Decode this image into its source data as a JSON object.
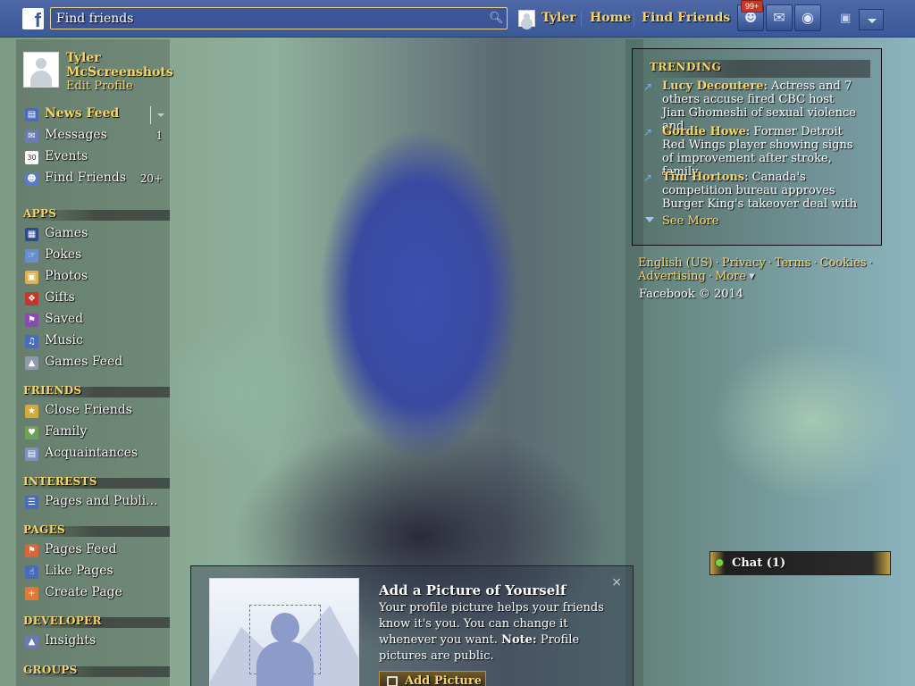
{
  "header": {
    "search": {
      "placeholder": "Find friends"
    },
    "user_name": "Tyler",
    "nav": {
      "home": "Home",
      "find_friends": "Find Friends"
    },
    "notification_badge": "99+",
    "colors": {
      "bar": "#3b5998",
      "accent": "#f5d46b"
    }
  },
  "profile": {
    "name": "Tyler McScreenshots",
    "edit_label": "Edit Profile"
  },
  "sidebar": {
    "favorites": [
      {
        "label": "News Feed",
        "icon": "news-feed-icon",
        "count": ""
      },
      {
        "label": "Messages",
        "icon": "messages-icon",
        "count": "1"
      },
      {
        "label": "Events",
        "icon": "calendar-icon",
        "count": "",
        "glyph": "30"
      },
      {
        "label": "Find Friends",
        "icon": "find-friends-icon",
        "count": "20+"
      }
    ],
    "apps_header": "APPS",
    "apps": [
      {
        "label": "Games",
        "icon": "games-icon"
      },
      {
        "label": "Pokes",
        "icon": "pokes-icon"
      },
      {
        "label": "Photos",
        "icon": "photos-icon"
      },
      {
        "label": "Gifts",
        "icon": "gifts-icon"
      },
      {
        "label": "Saved",
        "icon": "saved-icon"
      },
      {
        "label": "Music",
        "icon": "music-icon"
      },
      {
        "label": "Games Feed",
        "icon": "games-feed-icon"
      }
    ],
    "friends_header": "FRIENDS",
    "friends": [
      {
        "label": "Close Friends",
        "icon": "close-friends-icon"
      },
      {
        "label": "Family",
        "icon": "family-icon"
      },
      {
        "label": "Acquaintances",
        "icon": "acquaintances-icon"
      }
    ],
    "interests_header": "INTERESTS",
    "interests": [
      {
        "label": "Pages and Publi...",
        "icon": "rss-icon"
      }
    ],
    "pages_header": "PAGES",
    "pages": [
      {
        "label": "Pages Feed",
        "icon": "pages-feed-icon"
      },
      {
        "label": "Like Pages",
        "icon": "like-icon"
      },
      {
        "label": "Create Page",
        "icon": "create-page-icon"
      }
    ],
    "developer_header": "DEVELOPER",
    "developer": [
      {
        "label": "Insights",
        "icon": "insights-icon"
      }
    ],
    "groups_header": "GROUPS"
  },
  "trending": {
    "header": "TRENDING",
    "items": [
      {
        "name": "Lucy Decoutere",
        "text": ": Actress and 7 others accuse fired CBC host Jian Ghomeshi of sexual violence and"
      },
      {
        "name": "Gordie Howe",
        "text": ": Former Detroit Red Wings player showing signs of improvement after stroke, family"
      },
      {
        "name": "Tim Hortons",
        "text": ": Canada's competition bureau approves Burger King's takeover deal with"
      }
    ],
    "see_more": "See More"
  },
  "footer": {
    "links": [
      "English (US)",
      "Privacy",
      "Terms",
      "Cookies",
      "Advertising",
      "More"
    ],
    "copyright": "Facebook © 2014"
  },
  "chat": {
    "label": "Chat (1)"
  },
  "profile_picture_prompt": {
    "title": "Add a Picture of Yourself",
    "body": "Your profile picture helps your friends know it's you. You can change it whenever you want. ",
    "note_label": "Note:",
    "note_text": " Profile pictures are public.",
    "button": "Add Picture",
    "close": "×"
  }
}
